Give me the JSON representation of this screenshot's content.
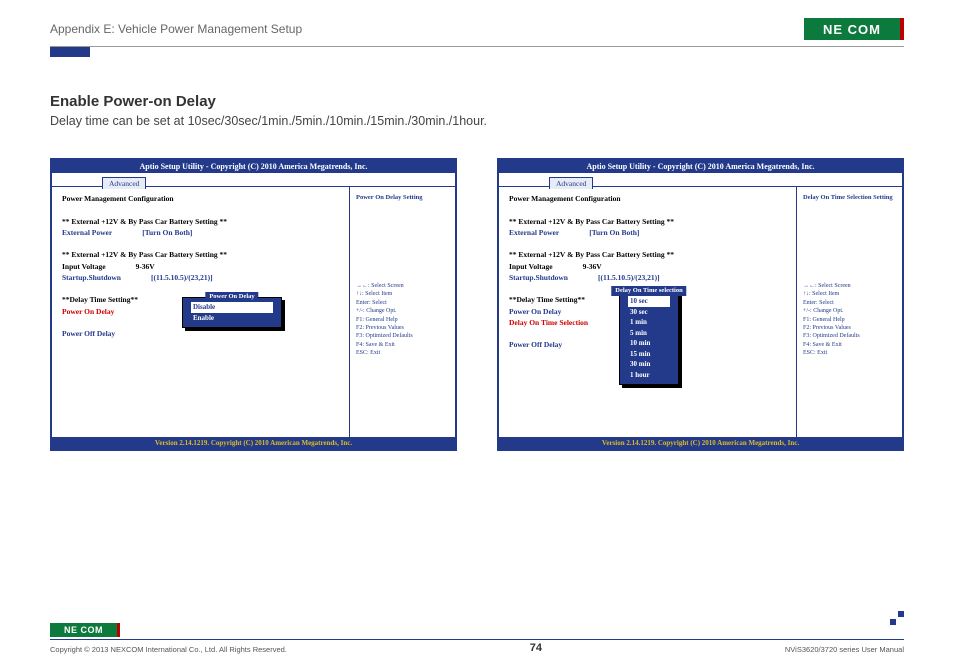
{
  "header": {
    "appendix": "Appendix E: Vehicle Power Management Setup",
    "logo_text": "NE COM"
  },
  "section": {
    "title": "Enable Power-on Delay",
    "desc": "Delay time can be set at 10sec/30sec/1min./5min./10min./15min./30min./1hour."
  },
  "bios_common": {
    "title": "Aptio Setup Utility - Copyright (C) 2010 America Megatrends, Inc.",
    "tab": "Advanced",
    "pm_heading": "Power Management Configuration",
    "ext_heading": "** External +12V & By Pass Car Battery Setting **",
    "ext_power": "External Power",
    "ext_power_val": "[Turn On Both]",
    "input_voltage": "Input Voltage",
    "input_voltage_val": "9-36V",
    "startup": "Startup.Shutdown",
    "startup_val": "[(11.5.10.5)/(23,21)]",
    "delay_heading": "**Delay Time Setting**",
    "power_on_delay": "Power On Delay",
    "power_off_delay": "Power Off Delay",
    "footer": "Version 2.14.1219. Copyright (C) 2010 American Megatrends, Inc.",
    "hints": [
      "→←: Select Screen",
      "↑↓: Select Item",
      "Enter: Select",
      "+/-: Change Opt.",
      "F1: General Help",
      "F2: Previous Values",
      "F3: Optimized Defaults",
      "F4: Save & Exit",
      "ESC: Exit"
    ]
  },
  "bios_left": {
    "right_heading": "Power On Delay Setting",
    "popup_title": "Power On Delay",
    "popup_options": [
      "Disable",
      "Enable"
    ],
    "popup_selected": 0
  },
  "bios_right": {
    "right_heading": "Delay On Time Selection Setting",
    "delay_on_time_label": "Delay On Time Selection",
    "popup_title": "Delay On Time selection",
    "popup_options": [
      "10 sec",
      "30 sec",
      "1 min",
      "5 min",
      "10 min",
      "15 min",
      "30 min",
      "1 hour"
    ],
    "popup_selected": 0
  },
  "footer": {
    "copyright": "Copyright © 2013 NEXCOM International Co., Ltd. All Rights Reserved.",
    "page": "74",
    "doc": "NViS3620/3720 series User Manual"
  }
}
